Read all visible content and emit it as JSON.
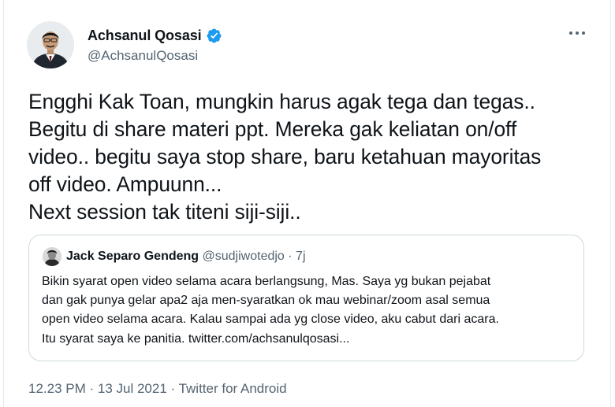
{
  "author": {
    "name": "Achsanul Qosasi",
    "handle": "@AchsanulQosasi",
    "verified": true,
    "avatar_icon": "person-portrait-icon"
  },
  "more_icon": "more-options-icon",
  "tweet": {
    "lines": [
      "Engghi Kak Toan, mungkin harus agak tega dan tegas..",
      "Begitu di share materi ppt. Mereka gak keliatan on/off",
      "video.. begitu saya stop share, baru ketahuan mayoritas",
      "off video. Ampuunn...",
      "Next session tak titeni siji-siji.."
    ]
  },
  "quote": {
    "name": "Jack Separo Gendeng",
    "handle": "@sudjiwotedjo",
    "separator": "·",
    "time": "7j",
    "lines": [
      "Bikin syarat open video selama acara berlangsung, Mas. Saya yg bukan pejabat",
      "dan gak punya gelar apa2 aja men-syaratkan ok mau webinar/zoom asal semua",
      "open video selama acara. Kalau sampai ada yg close video, aku cabut dari acara.",
      "Itu syarat saya ke panitia. twitter.com/achsanulqosasi..."
    ]
  },
  "footer": {
    "text": "12.23 PM · 13 Jul 2021 · Twitter for Android"
  },
  "colors": {
    "text": "#0f1419",
    "secondary": "#536471",
    "verified": "#1d9bf0",
    "border": "#cfd9de"
  }
}
